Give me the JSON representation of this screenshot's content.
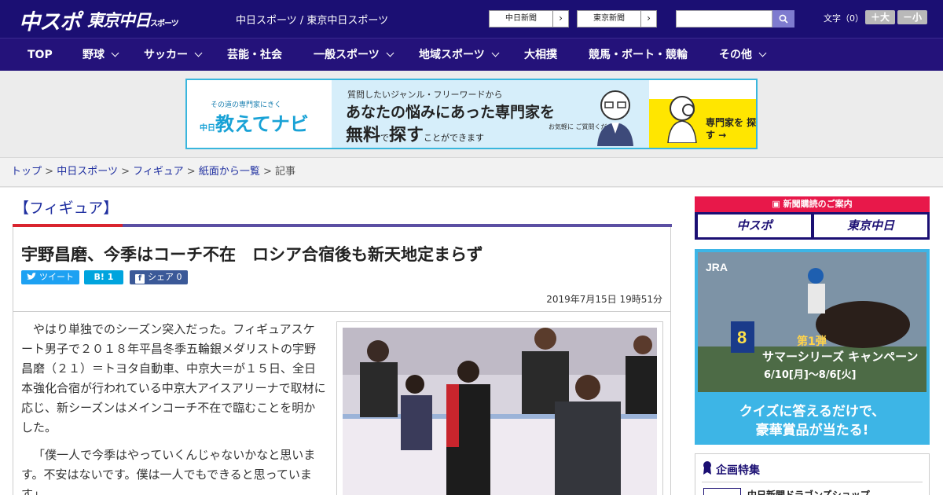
{
  "header": {
    "logo_main": "中スポ",
    "logo_sub": "東京中日",
    "logo_sub_small": "スポーツ",
    "site_links": "中日スポーツ / 東京中日スポーツ",
    "btn_chunichi": "中日新聞",
    "btn_tokyo": "東京新聞",
    "arrow": "›",
    "search_placeholder": "",
    "fontsize_label": "文字（0）",
    "fontsize_plus": "＋大",
    "fontsize_minus": "－小"
  },
  "nav": [
    {
      "label": "TOP"
    },
    {
      "label": "野球"
    },
    {
      "label": "サッカー"
    },
    {
      "label": "芸能・社会"
    },
    {
      "label": "一般スポーツ"
    },
    {
      "label": "地域スポーツ"
    },
    {
      "label": "大相撲"
    },
    {
      "label": "競馬・ボート・競輪"
    },
    {
      "label": "その他"
    }
  ],
  "banner": {
    "small": "その道の専門家にきく",
    "brand_small": "中日",
    "brand": "教えてナビ",
    "line1": "質問したいジャンル・フリーワードから",
    "line2": "あなたの悩みにあった専門家を",
    "line3_a": "無料",
    "line3_b": "で",
    "line3_c": "探す",
    "line3_d": "ことができます",
    "line4": "お気軽に ご質問ください！",
    "cta": "専門家を 探す →"
  },
  "breadcrumb": {
    "items": [
      "トップ",
      "中日スポーツ",
      "フィギュア",
      "紙面から一覧"
    ],
    "current": "記事",
    "sep": ">"
  },
  "article": {
    "category": "【フィギュア】",
    "headline": "宇野昌磨、今季はコーチ不在　ロシア合宿後も新天地定まらず",
    "share_tweet": "ツイート",
    "share_hatena": "B! 1",
    "share_fb": "シェア 0",
    "date": "2019年7月15日 19時51分",
    "para1": "やはり単独でのシーズン突入だった。フィギュアスケート男子で２０１８年平昌冬季五輪銀メダリストの宇野昌磨（２１）＝トヨタ自動車、中京大＝が１５日、全日本強化合宿が行われている中京大アイスアリーナで取材に応じ、新シーズンはメインコーチ不在で臨むことを明かした。",
    "para2": "「僕一人で今季はやっていくんじゃないかなと思います。不安はないです。僕は一人でもできると思っています」"
  },
  "sidebar": {
    "sub_title": "新聞購読のご案内",
    "sub_btn1": "中スポ",
    "sub_btn2": "東京中日",
    "ad_brand": "JRA",
    "ad_round": "第1弾",
    "ad_title": "サマーシリーズ キャンペーン",
    "ad_dates": "6/10[月]～8/6[火]",
    "ad_cta1": "クイズに答えるだけで、",
    "ad_cta2": "豪華賞品が当たる!",
    "feature_title": "企画特集",
    "feature_item": "中日新聞ドラゴンズショップ"
  },
  "colors": {
    "header_bg": "#1b0f73",
    "nav_bg": "#24127a",
    "link": "#1f2fa0",
    "accent_red": "#d9242f",
    "twitter": "#1da1f2",
    "hatena": "#00a4de",
    "facebook": "#3b5998"
  }
}
